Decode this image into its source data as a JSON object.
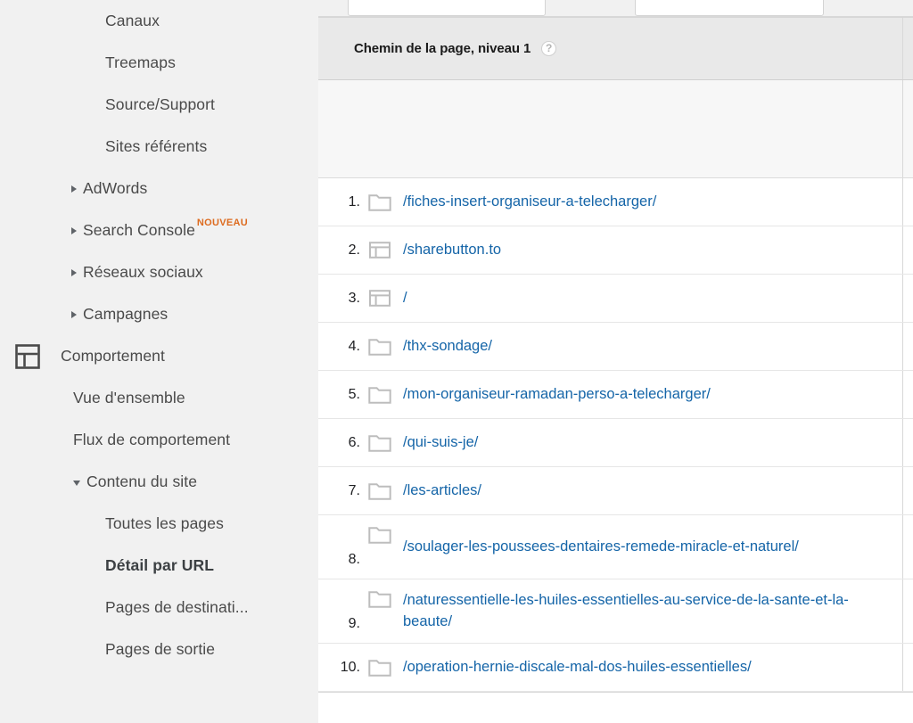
{
  "sidebar": {
    "items": [
      {
        "label": "Canaux",
        "level": "deep",
        "icon": "none",
        "active": false
      },
      {
        "label": "Treemaps",
        "level": "deep",
        "icon": "none",
        "active": false
      },
      {
        "label": "Source/Support",
        "level": "deep",
        "icon": "none",
        "active": false
      },
      {
        "label": "Sites référents",
        "level": "deep",
        "icon": "none",
        "active": false
      },
      {
        "label": "AdWords",
        "level": "arrow",
        "icon": "caret-right-icon",
        "active": false
      },
      {
        "label": "Search Console",
        "level": "arrow",
        "icon": "caret-right-icon",
        "active": false,
        "badge": "NOUVEAU"
      },
      {
        "label": "Réseaux sociaux",
        "level": "arrow",
        "icon": "caret-right-icon",
        "active": false
      },
      {
        "label": "Campagnes",
        "level": "arrow",
        "icon": "caret-right-icon",
        "active": false
      },
      {
        "label": "Comportement",
        "level": "section",
        "icon": "behavior-icon",
        "active": false
      },
      {
        "label": "Vue d'ensemble",
        "level": "two",
        "icon": "none",
        "active": false
      },
      {
        "label": "Flux de comportement",
        "level": "two",
        "icon": "none",
        "active": false
      },
      {
        "label": "Contenu du site",
        "level": "two-caret",
        "icon": "caret-down-icon",
        "active": false
      },
      {
        "label": "Toutes les pages",
        "level": "three",
        "icon": "none",
        "active": false
      },
      {
        "label": "Détail par URL",
        "level": "three",
        "icon": "none",
        "active": true
      },
      {
        "label": "Pages de destinati...",
        "level": "three",
        "icon": "none",
        "active": false
      },
      {
        "label": "Pages de sortie",
        "level": "three",
        "icon": "none",
        "active": false
      }
    ],
    "badge_color": "#dd6b1f"
  },
  "filters": {
    "input_one_value": "",
    "input_two_value": ""
  },
  "table": {
    "header": {
      "title": "Chemin de la page, niveau 1",
      "help_tooltip": "?"
    },
    "link_color": "#1565a8",
    "rows": [
      {
        "index": "1.",
        "icon": "folder-icon",
        "label": "/fiches-insert-organiseur-a-telecharger/",
        "tall": false
      },
      {
        "index": "2.",
        "icon": "page-icon",
        "label": "/sharebutton.to",
        "tall": false
      },
      {
        "index": "3.",
        "icon": "page-icon",
        "label": "/",
        "tall": false
      },
      {
        "index": "4.",
        "icon": "folder-icon",
        "label": "/thx-sondage/",
        "tall": false
      },
      {
        "index": "5.",
        "icon": "folder-icon",
        "label": "/mon-organiseur-ramadan-perso-a-telecharger/",
        "tall": false
      },
      {
        "index": "6.",
        "icon": "folder-icon",
        "label": "/qui-suis-je/",
        "tall": false
      },
      {
        "index": "7.",
        "icon": "folder-icon",
        "label": "/les-articles/",
        "tall": false
      },
      {
        "index": "8.",
        "icon": "folder-icon",
        "label": "/soulager-les-poussees-dentaires-remede-miracle-et-naturel/",
        "tall": true
      },
      {
        "index": "9.",
        "icon": "folder-icon",
        "label": "/naturessentielle-les-huiles-essentielles-au-service-de-la-sante-et-la-beaute/",
        "tall": true
      },
      {
        "index": "10.",
        "icon": "folder-icon",
        "label": "/operation-hernie-discale-mal-dos-huiles-essentielles/",
        "tall": false
      }
    ]
  }
}
